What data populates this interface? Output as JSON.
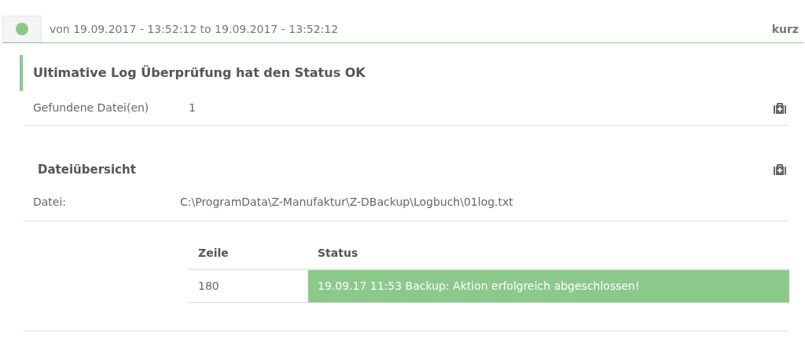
{
  "header": {
    "color": "#8bc98b",
    "range": "von 19.09.2017 - 13:52:12 to 19.09.2017 - 13:52:12",
    "mode": "kurz"
  },
  "check": {
    "title": "Ultimative Log Überprüfung hat den Status OK",
    "label": "Gefundene Datei(en)",
    "value": "1"
  },
  "overview": {
    "title": "Dateiübersicht",
    "label": "Datei:",
    "path": "C:\\ProgramData\\Z-Manufaktur\\Z-DBackup\\Logbuch\\01log.txt",
    "table": {
      "columns": [
        "Zeile",
        "Status"
      ],
      "rows": [
        {
          "line": "180",
          "status": "19.09.17 11:53 Backup: Aktion erfolgreich abgeschlossen!",
          "color": "#8bc98b"
        }
      ]
    }
  }
}
